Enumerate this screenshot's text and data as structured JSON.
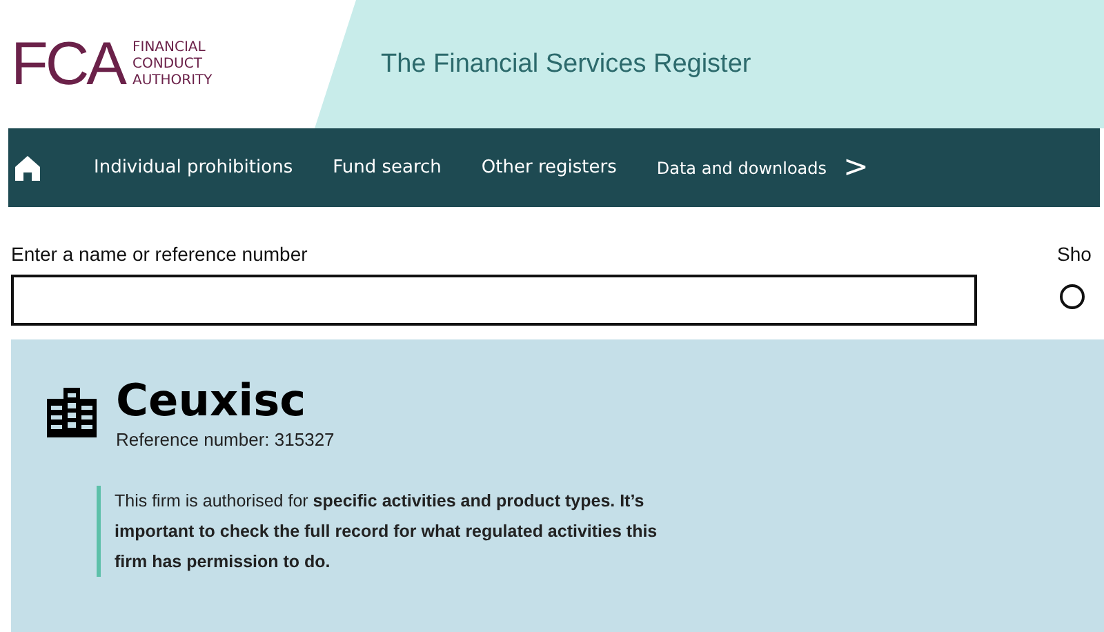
{
  "logo": {
    "mark": "FCA",
    "lines": [
      "FINANCIAL",
      "CONDUCT",
      "AUTHORITY"
    ]
  },
  "header": {
    "title": "The Financial Services Register"
  },
  "nav": {
    "items": [
      "Individual prohibitions",
      "Fund search",
      "Other registers",
      "Data and downloads"
    ],
    "next": ">"
  },
  "search": {
    "label": "Enter a name or reference number"
  },
  "show": {
    "label": "Sho",
    "options": [
      {
        "selected": false
      }
    ]
  },
  "firm": {
    "name": "Ceuxisc",
    "reference": "Reference number: 315327",
    "notice": "This firm is authorised for **specific activities and product types. It’s important to check the full record for what regulated activities this firm has permission to do.**"
  }
}
